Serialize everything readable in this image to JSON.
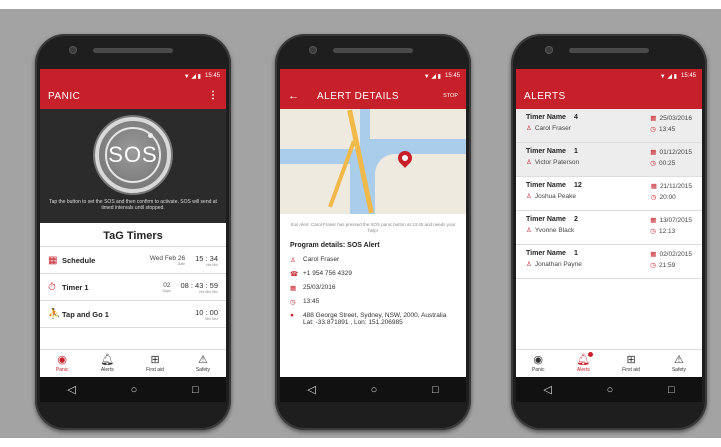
{
  "status": {
    "time": "15:45",
    "signal": "▼ ◢ ▮"
  },
  "tabs": [
    {
      "label": "Panic",
      "icon": "sos-icon"
    },
    {
      "label": "Alerts",
      "icon": "bell-icon"
    },
    {
      "label": "First aid",
      "icon": "first-aid-icon"
    },
    {
      "label": "Safety",
      "icon": "warning-icon"
    }
  ],
  "panic": {
    "title": "PANIC",
    "sos_label": "SOS",
    "hint": "Tap the button to set the SOS and then confirm to activate. SOS will send at timed intervals until stopped.",
    "timers_title": "TaG Timers",
    "timers": [
      {
        "name": "Schedule",
        "mid": "Wed Feb 26",
        "mid_sub": "Date",
        "value": "15 : 34",
        "value_sub": "Hrs    Min"
      },
      {
        "name": "Timer 1",
        "mid": "02",
        "mid_sub": "Days",
        "value": "08 : 43 : 59",
        "value_sub": "Hrs   Min   Sec"
      },
      {
        "name": "Tap and Go 1",
        "mid": "",
        "mid_sub": "",
        "value": "10 : 00",
        "value_sub": "Min    Sec"
      }
    ]
  },
  "details": {
    "title": "ALERT DETAILS",
    "stop": "STOP",
    "message": "Sos Alert. Carol Fraser has pressed the SOS panic button at 13:45 and needs your help!",
    "program_title": "Program details: SOS Alert",
    "rows": [
      {
        "icon": "person-icon",
        "glyph": "♙",
        "text": "Carol Fraser"
      },
      {
        "icon": "phone-icon",
        "glyph": "☎",
        "text": "+1 954 756 4329"
      },
      {
        "icon": "calendar-icon",
        "glyph": "▦",
        "text": "25/03/2016"
      },
      {
        "icon": "clock-icon",
        "glyph": "◷",
        "text": "13:45"
      },
      {
        "icon": "location-icon",
        "glyph": "●",
        "text": "488 George Street, Sydney, NSW, 2000, Australia"
      },
      {
        "icon": "",
        "glyph": "",
        "text": "Lat: -33.871891 , Lon: 151.206985"
      }
    ]
  },
  "alerts": {
    "title": "ALERTS",
    "items": [
      {
        "name": "Timer Name",
        "num": "4",
        "person": "Carol Fraser",
        "date": "25/03/2016",
        "time": "13:45",
        "shade": true
      },
      {
        "name": "Timer Name",
        "num": "1",
        "person": "Victor Paterson",
        "date": "01/12/2015",
        "time": "00:25",
        "shade": true
      },
      {
        "name": "Timer Name",
        "num": "12",
        "person": "Joshua Peake",
        "date": "21/11/2015",
        "time": "20:00",
        "shade": false
      },
      {
        "name": "Timer Name",
        "num": "2",
        "person": "Yvonne Black",
        "date": "13/07/2015",
        "time": "12:13",
        "shade": false
      },
      {
        "name": "Timer Name",
        "num": "1",
        "person": "Jonathan Payne",
        "date": "02/02/2015",
        "time": "21:59",
        "shade": false
      }
    ]
  },
  "colors": {
    "accent": "#c6202a",
    "dark": "#2b2b2b",
    "background": "#a3a3a3"
  }
}
